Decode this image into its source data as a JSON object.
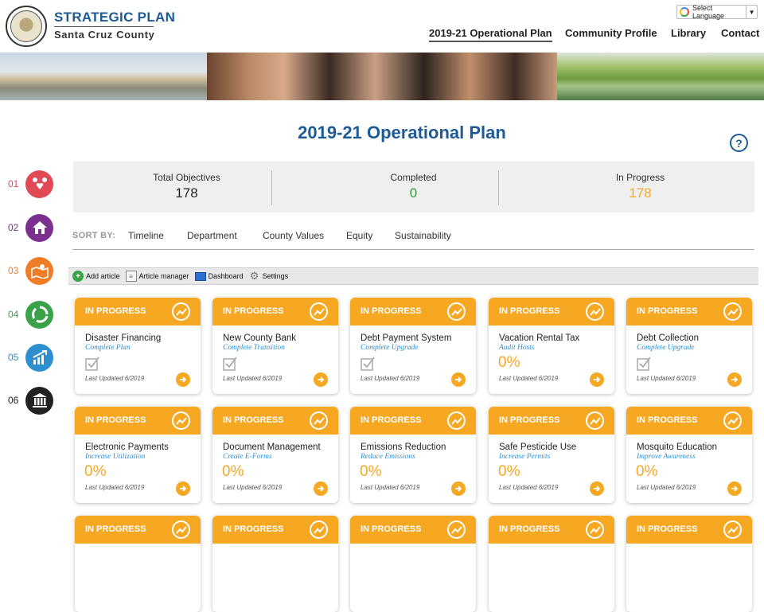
{
  "header": {
    "brand_title": "STRATEGIC PLAN",
    "brand_subtitle": "Santa Cruz County",
    "language_label": "Select Language",
    "nav": [
      {
        "label": "2019-21 Operational Plan",
        "active": true
      },
      {
        "label": "Community Profile"
      },
      {
        "label": "Library"
      },
      {
        "label": "Contact"
      }
    ]
  },
  "page": {
    "title": "2019-21 Operational Plan",
    "help_label": "?"
  },
  "sidebar": [
    {
      "num": "01",
      "icon": "people-heart-icon",
      "color": "#e04a55"
    },
    {
      "num": "02",
      "icon": "house-icon",
      "color": "#7b2f8e"
    },
    {
      "num": "03",
      "icon": "map-pin-icon",
      "color": "#f07c26"
    },
    {
      "num": "04",
      "icon": "recycle-icon",
      "color": "#3aa34a"
    },
    {
      "num": "05",
      "icon": "growth-chart-icon",
      "color": "#2d8fd0"
    },
    {
      "num": "06",
      "icon": "government-building-icon",
      "color": "#222222"
    }
  ],
  "stats": [
    {
      "label": "Total Objectives",
      "value": "178",
      "color": "#222222"
    },
    {
      "label": "Completed",
      "value": "0",
      "color": "#3a9a3a"
    },
    {
      "label": "In Progress",
      "value": "178",
      "color": "#f6a823"
    }
  ],
  "sort": {
    "label": "SORT BY:",
    "options": [
      "Timeline",
      "Department",
      "County Values",
      "Equity",
      "Sustainability"
    ]
  },
  "toolbar": {
    "items": [
      {
        "label": "Add article",
        "icon": "plus-circle-icon"
      },
      {
        "label": "Article manager",
        "icon": "article-manager-icon"
      },
      {
        "label": "Dashboard",
        "icon": "monitor-icon"
      },
      {
        "label": "Settings",
        "icon": "gear-icon"
      }
    ]
  },
  "cards": [
    {
      "status": "IN PROGRESS",
      "title": "Disaster Financing",
      "subtitle": "Complete Plan",
      "pct": "",
      "updated": "Last Updated 6/2019"
    },
    {
      "status": "IN PROGRESS",
      "title": "New County Bank",
      "subtitle": "Complete Transition",
      "pct": "",
      "updated": "Last Updated 6/2019"
    },
    {
      "status": "IN PROGRESS",
      "title": "Debt Payment System",
      "subtitle": "Complete Upgrade",
      "pct": "",
      "updated": "Last Updated 6/2019"
    },
    {
      "status": "IN PROGRESS",
      "title": "Vacation Rental Tax",
      "subtitle": "Audit Hosts",
      "pct": "0%",
      "updated": "Last Updated 6/2019"
    },
    {
      "status": "IN PROGRESS",
      "title": "Debt Collection",
      "subtitle": "Complete Upgrade",
      "pct": "",
      "updated": "Last Updated 6/2019"
    },
    {
      "status": "IN PROGRESS",
      "title": "Electronic Payments",
      "subtitle": "Increase Utilization",
      "pct": "0%",
      "updated": "Last Updated 6/2019"
    },
    {
      "status": "IN PROGRESS",
      "title": "Document Management",
      "subtitle": "Create E-Forms",
      "pct": "0%",
      "updated": "Last Updated 6/2019"
    },
    {
      "status": "IN PROGRESS",
      "title": "Emissions Reduction",
      "subtitle": "Reduce Emissions",
      "pct": "0%",
      "updated": "Last Updated 6/2019"
    },
    {
      "status": "IN PROGRESS",
      "title": "Safe Pesticide Use",
      "subtitle": "Increase Permits",
      "pct": "0%",
      "updated": "Last Updated 6/2019"
    },
    {
      "status": "IN PROGRESS",
      "title": "Mosquito Education",
      "subtitle": "Improve Awareness",
      "pct": "0%",
      "updated": "Last Updated 6/2019"
    },
    {
      "status": "IN PROGRESS",
      "title": "",
      "subtitle": "",
      "pct": "",
      "updated": ""
    },
    {
      "status": "IN PROGRESS",
      "title": "",
      "subtitle": "",
      "pct": "",
      "updated": ""
    },
    {
      "status": "IN PROGRESS",
      "title": "",
      "subtitle": "",
      "pct": "",
      "updated": ""
    },
    {
      "status": "IN PROGRESS",
      "title": "",
      "subtitle": "",
      "pct": "",
      "updated": ""
    },
    {
      "status": "IN PROGRESS",
      "title": "",
      "subtitle": "",
      "pct": "",
      "updated": ""
    }
  ]
}
